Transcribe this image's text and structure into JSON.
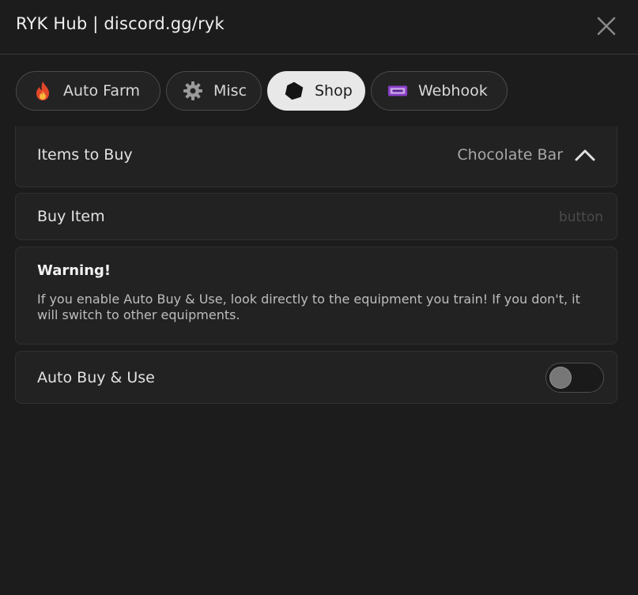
{
  "window": {
    "title": "RYK Hub | discord.gg/ryk"
  },
  "tabs": [
    {
      "label": "Auto Farm",
      "icon": "fire-icon",
      "active": false
    },
    {
      "label": "Misc",
      "icon": "gear-icon",
      "active": false
    },
    {
      "label": "Shop",
      "icon": "cube-icon",
      "active": true
    },
    {
      "label": "Webhook",
      "icon": "badge-icon",
      "active": false
    }
  ],
  "shop": {
    "items_to_buy": {
      "label": "Items to Buy",
      "value": "Chocolate Bar"
    },
    "buy_item": {
      "label": "Buy Item",
      "hint": "button"
    },
    "warning": {
      "title": "Warning!",
      "text": "If you enable Auto Buy & Use, look directly to the equipment you train! If you don't, it\nwill switch to other equipments."
    },
    "auto_buy_use": {
      "label": "Auto Buy & Use",
      "enabled": false
    }
  },
  "colors": {
    "background": "#1c1c1c",
    "card": "#222222",
    "active_tab": "#e8e8e8",
    "fire": "#e2472a",
    "badge": "#8a3fc7"
  }
}
